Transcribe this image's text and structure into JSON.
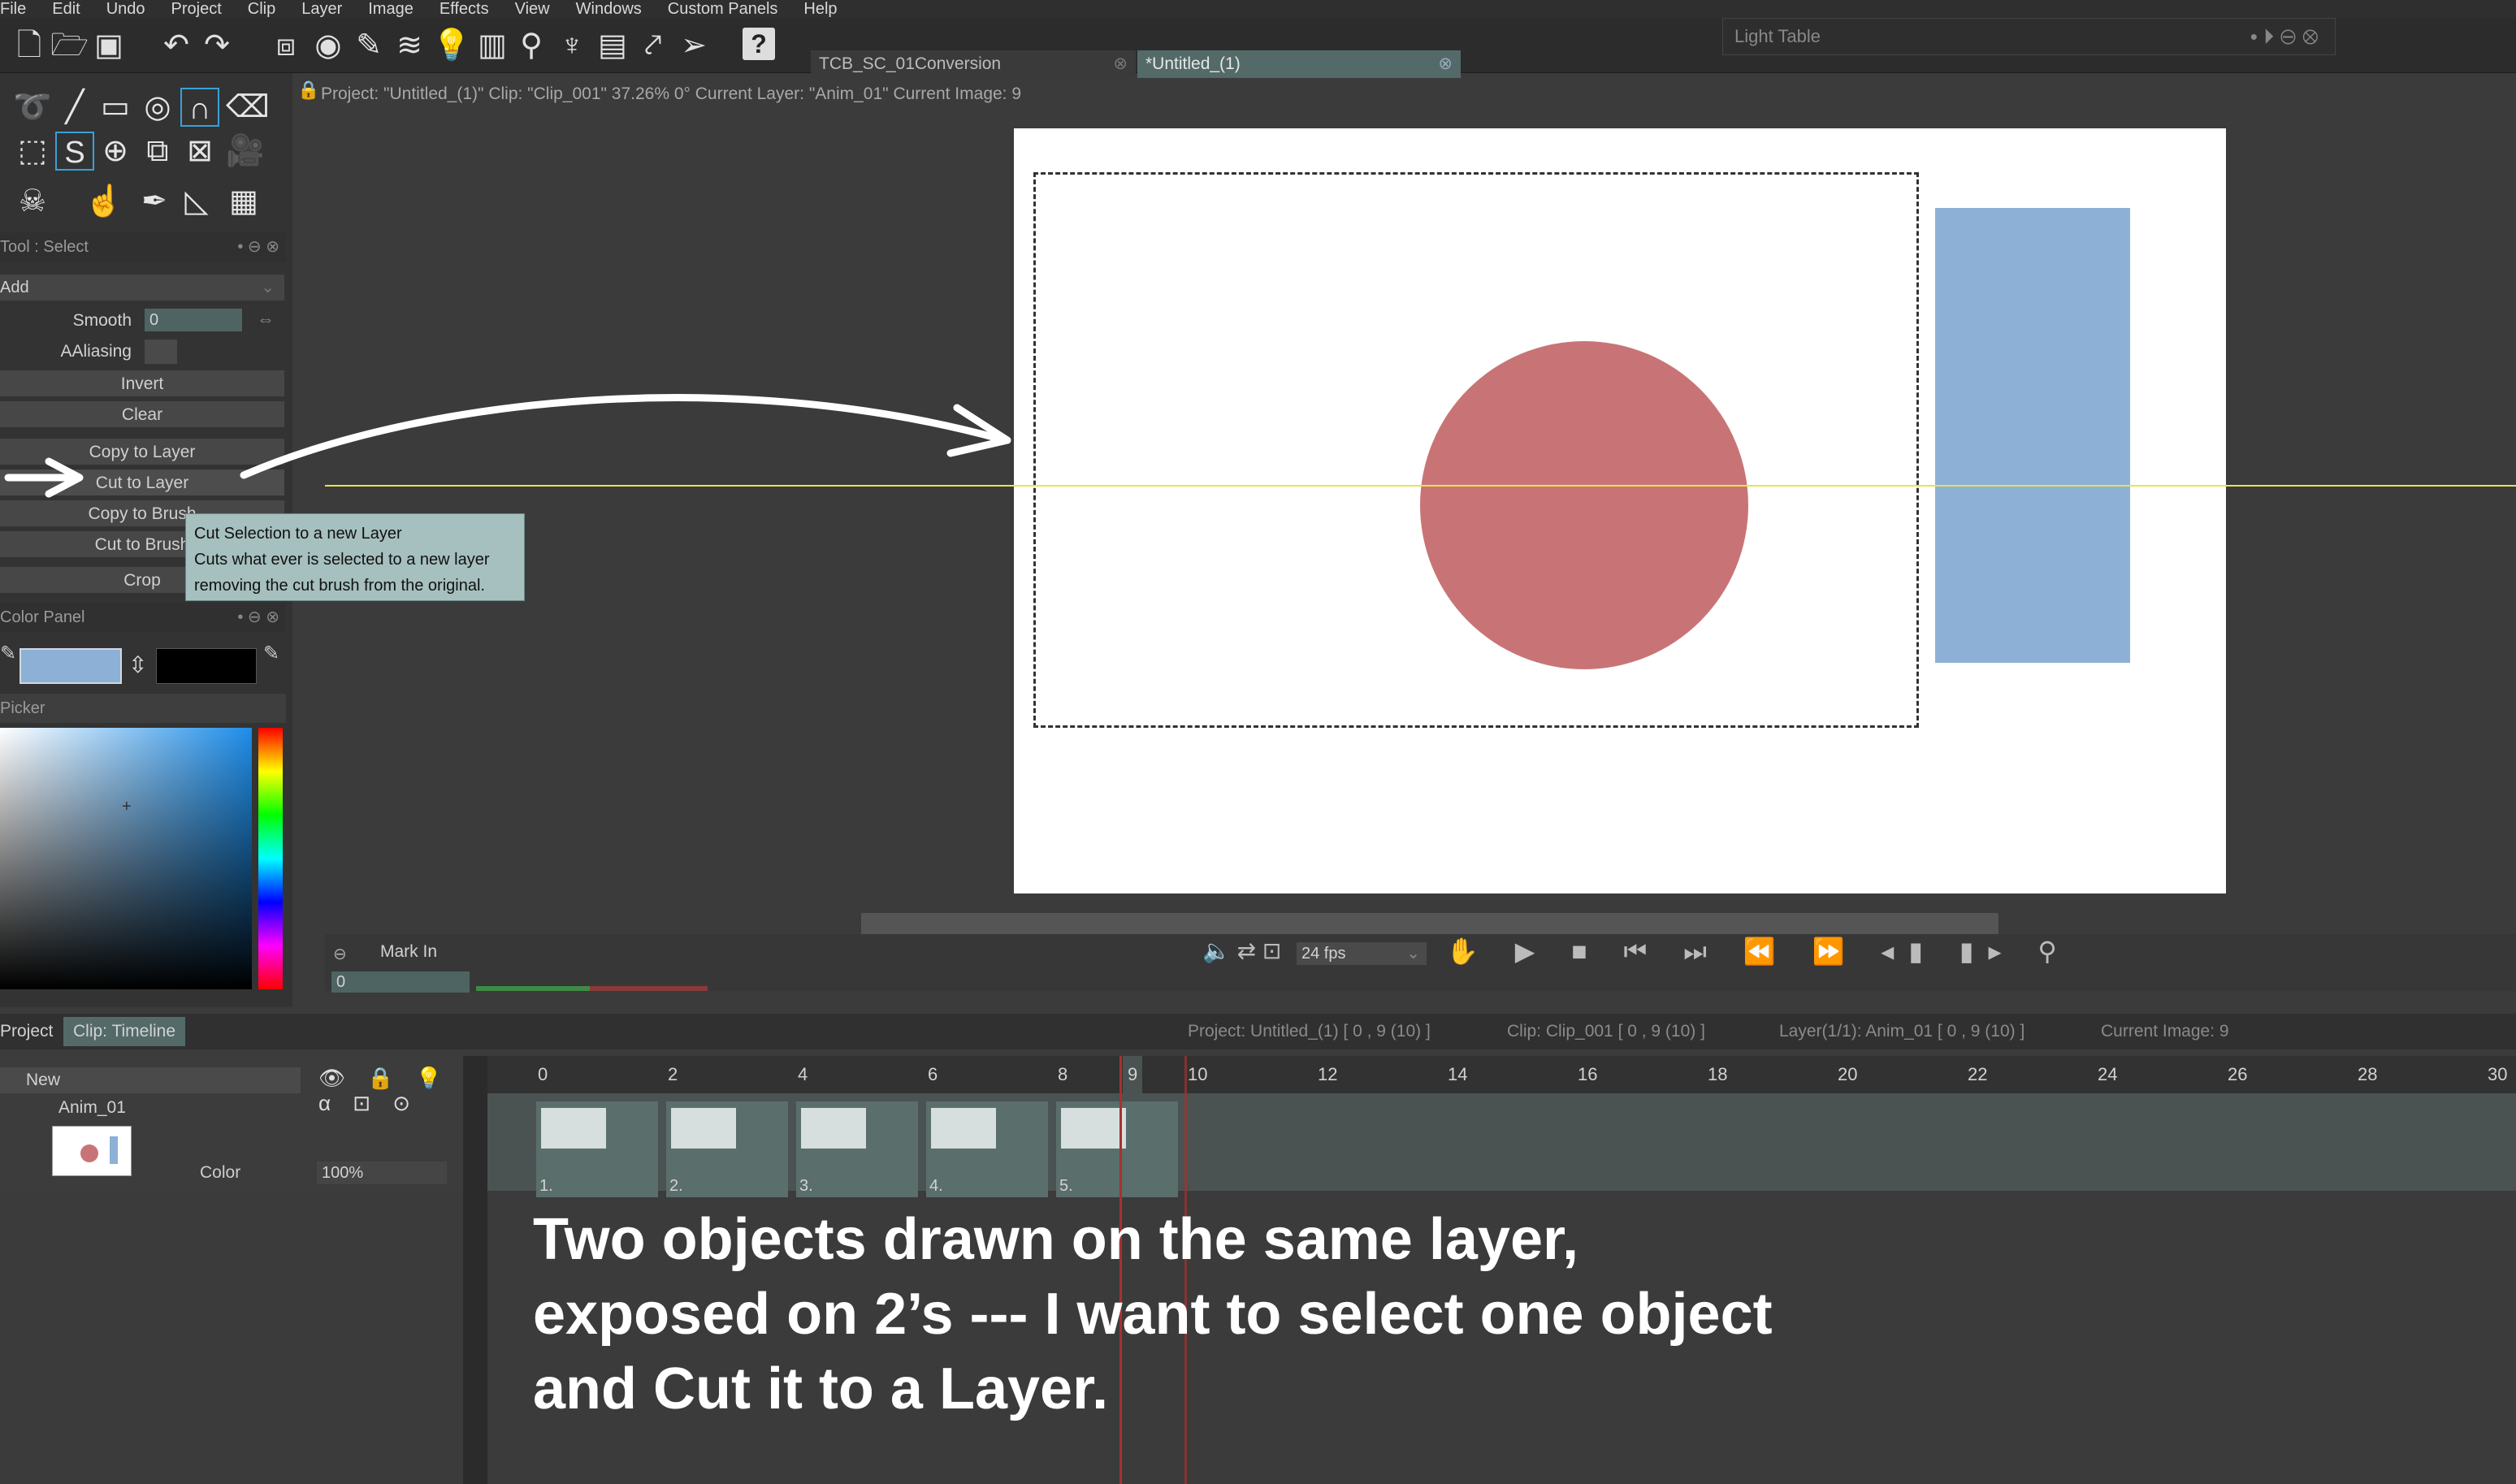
{
  "menu": [
    "File",
    "Edit",
    "Undo",
    "Project",
    "Clip",
    "Layer",
    "Image",
    "Effects",
    "View",
    "Windows",
    "Custom Panels",
    "Help"
  ],
  "doc_tabs": [
    {
      "label": "TCB_SC_01Conversion"
    },
    {
      "label": "*Untitled_(1)"
    }
  ],
  "light_table": {
    "label": "Light Table"
  },
  "info_bar": "Project: \"Untitled_(1)\"  Clip: \"Clip_001\"   37.26%   0°   Current Layer: \"Anim_01\"   Current Image: 9",
  "tool_panel": {
    "title": "Tool : Select",
    "mode": "Add",
    "smooth_label": "Smooth",
    "smooth_value": "0",
    "aaliasing_label": "AAliasing",
    "buttons": [
      "Invert",
      "Clear",
      "Copy to Layer",
      "Cut to Layer",
      "Copy to Brush",
      "Cut to Brush",
      "Crop"
    ]
  },
  "tooltip": {
    "line1": "Cut Selection to a new Layer",
    "line2": "Cuts what ever is selected to a new layer",
    "line3": "removing the cut brush from the original."
  },
  "color_panel": {
    "title": "Color Panel",
    "picker_label": "Picker",
    "primary": "#8db0d6",
    "secondary": "#000000"
  },
  "transport": {
    "mark_in": "Mark In",
    "fps": "24 fps",
    "frame_value": "0"
  },
  "timeline": {
    "tabs": [
      "Project",
      "Clip: Timeline"
    ],
    "status": [
      "Project: Untitled_(1) [ 0 , 9  (10) ]",
      "Clip: Clip_001 [ 0 , 9  (10) ]",
      "Layer(1/1): Anim_01 [ 0 , 9  (10) ]",
      "Current Image: 9"
    ],
    "new_label": "New",
    "layer_name": "Anim_01",
    "color_label": "Color",
    "opacity": "100%",
    "ruler": [
      "0",
      "2",
      "4",
      "6",
      "8",
      "9",
      "10",
      "12",
      "14",
      "16",
      "18",
      "20",
      "22",
      "24",
      "26",
      "28",
      "30"
    ],
    "frame_labels": [
      "1.",
      "2.",
      "3.",
      "4.",
      "5."
    ]
  },
  "caption": [
    "Two objects drawn on the same layer,",
    "exposed on 2’s  --- I want to select one object",
    "and Cut it to a Layer."
  ],
  "colors": {
    "circle": "#c87476",
    "rect": "#8db0d6",
    "guide": "#e7e352",
    "tooltip": "#a5c0be"
  }
}
